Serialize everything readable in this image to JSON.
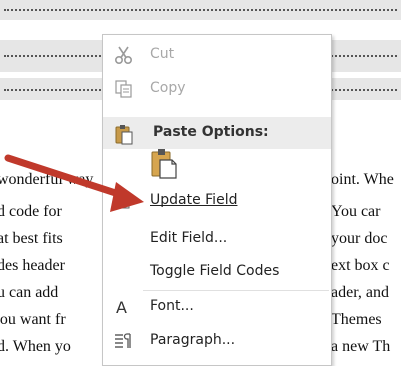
{
  "document": {
    "lines": [
      {
        "left": "wonderful way",
        "right": "oint. Whe"
      },
      {
        "left": "d code for",
        "right": "You car"
      },
      {
        "left": "at best fits",
        "right": "your doc"
      },
      {
        "left": "des header",
        "right": "ext box c"
      },
      {
        "left": "u can add",
        "right": "ader, and"
      },
      {
        "left": "'ou want fr",
        "right": "Themes"
      },
      {
        "left": "d. When yo",
        "right": "a new Th"
      }
    ]
  },
  "context_menu": {
    "cut": {
      "label": "Cut",
      "icon": "scissors-icon"
    },
    "copy": {
      "label": "Copy",
      "icon": "copy-icon"
    },
    "paste_options": {
      "label": "Paste Options:",
      "icon": "clipboard-icon"
    },
    "update_field": {
      "label": "Update Field",
      "icon": "update-field-icon"
    },
    "edit_field": {
      "label": "Edit Field..."
    },
    "toggle_field_codes": {
      "label": "Toggle Field Codes"
    },
    "font": {
      "label": "Font...",
      "icon": "font-icon"
    },
    "paragraph": {
      "label": "Paragraph...",
      "icon": "paragraph-icon"
    }
  },
  "colors": {
    "arrow": "#c0392b",
    "menu_border": "#c6c6c6",
    "disabled_text": "#a8a8a8"
  }
}
